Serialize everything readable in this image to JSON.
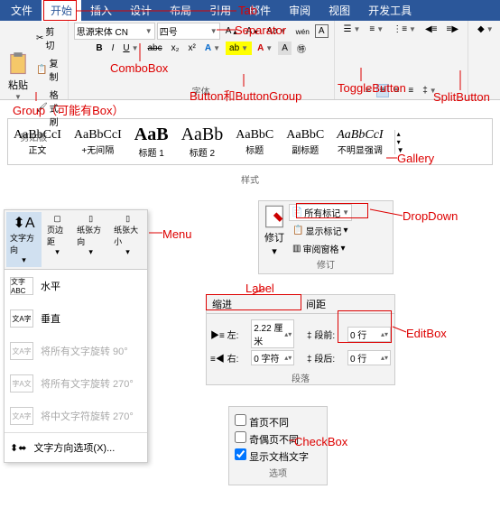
{
  "tabs": [
    "文件",
    "开始",
    "插入",
    "设计",
    "布局",
    "引用",
    "邮件",
    "审阅",
    "视图",
    "开发工具"
  ],
  "activeTab": 1,
  "clipboard": {
    "cut": "剪切",
    "copy": "复制",
    "brush": "格式刷",
    "paste": "粘贴",
    "label": "剪贴板"
  },
  "font": {
    "family": "思源宋体 CN",
    "size": "四号",
    "label": "字体"
  },
  "styles": {
    "label": "样式",
    "items": [
      {
        "sample": "AaBbCcI",
        "name": "正文"
      },
      {
        "sample": "AaBbCcI",
        "name": "+无间隔"
      },
      {
        "sample": "AaB",
        "name": "标题 1",
        "big": true,
        "bold": true
      },
      {
        "sample": "AaBb",
        "name": "标题 2",
        "big": true
      },
      {
        "sample": "AaBbC",
        "name": "标题"
      },
      {
        "sample": "AaBbC",
        "name": "副标题"
      },
      {
        "sample": "AaBbCcI",
        "name": "不明显强调",
        "italic": true
      }
    ]
  },
  "menu": {
    "title": "Menu",
    "btns": [
      "文字方向",
      "页边距",
      "纸张方向",
      "纸张大小"
    ],
    "items": [
      {
        "icon": "文字ABC",
        "label": "水平"
      },
      {
        "icon": "文A字",
        "label": "垂直"
      },
      {
        "icon": "文A字",
        "label": "将所有文字旋转 90°",
        "disabled": true
      },
      {
        "icon": "字A文",
        "label": "将所有文字旋转 270°",
        "disabled": true
      },
      {
        "icon": "文A字",
        "label": "将中文字符旋转 270°",
        "disabled": true
      }
    ],
    "footer": "文字方向选项(X)..."
  },
  "revise": {
    "btn": "修订",
    "allMarks": "所有标记",
    "showMarks": "显示标记",
    "reviewPane": "审阅窗格",
    "label": "修订"
  },
  "indent": {
    "h1": "缩进",
    "h2": "间距",
    "left": "左:",
    "right": "右:",
    "before": "段前:",
    "after": "段后:",
    "leftVal": "2.22 厘米",
    "rightVal": "0 字符",
    "beforeVal": "0 行",
    "afterVal": "0 行",
    "label": "段落"
  },
  "checks": {
    "c1": "首页不同",
    "c2": "奇偶页不同",
    "c3": "显示文档文字",
    "label": "选项"
  },
  "ann": {
    "tab": "Tab",
    "separator": "Separator",
    "combobox": "ComboBox",
    "buttonGroup": "Button和ButtonGroup",
    "toggle": "ToggleButton",
    "split": "SplitButton",
    "group": "Group（可能有Box）",
    "gallery": "Gallery",
    "menu": "Menu",
    "dropdown": "DropDown",
    "label": "Label",
    "editbox": "EditBox",
    "checkbox": "CheckBox"
  }
}
